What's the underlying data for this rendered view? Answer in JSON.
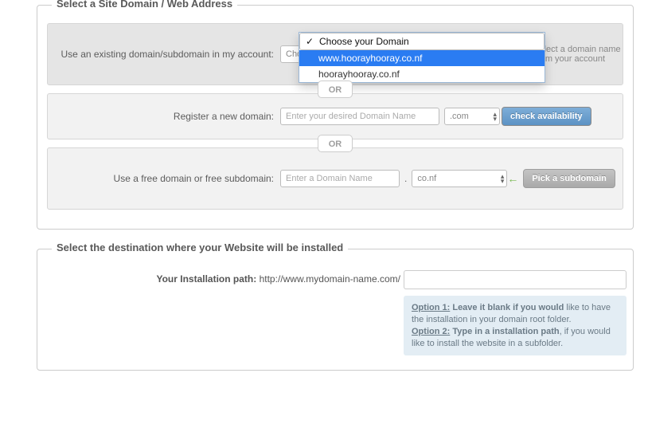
{
  "section1": {
    "legend": "Select a Site Domain / Web Address",
    "existing": {
      "label": "Use an existing domain/subdomain in my account:",
      "hint": "select a domain name from your account",
      "placeholder_opt": "Choose your Domain",
      "options": [
        "Choose your Domain",
        "www.hoorayhooray.co.nf",
        "hoorayhooray.co.nf"
      ]
    },
    "or": "OR",
    "register": {
      "label": "Register a new domain:",
      "placeholder": "Enter your desired Domain Name",
      "tld": ".com",
      "button": "check availability"
    },
    "free": {
      "label": "Use a free domain or free subdomain:",
      "placeholder": "Enter a Domain Name",
      "tld": "co.nf",
      "button": "Pick a subdomain"
    }
  },
  "section2": {
    "legend": "Select the destination where your Website will be installed",
    "path_label_bold": "Your Installation path:",
    "path_prefix": "http://www.mydomain-name.com/",
    "note": {
      "o1a": "Option 1:",
      "o1b": "Leave it blank if you would",
      "o1c": " like to have the installation in your domain root folder.",
      "o2a": "Option 2:",
      "o2b": "Type in a installation path",
      "o2c": ", if you would like to install the website in a subfolder."
    }
  }
}
